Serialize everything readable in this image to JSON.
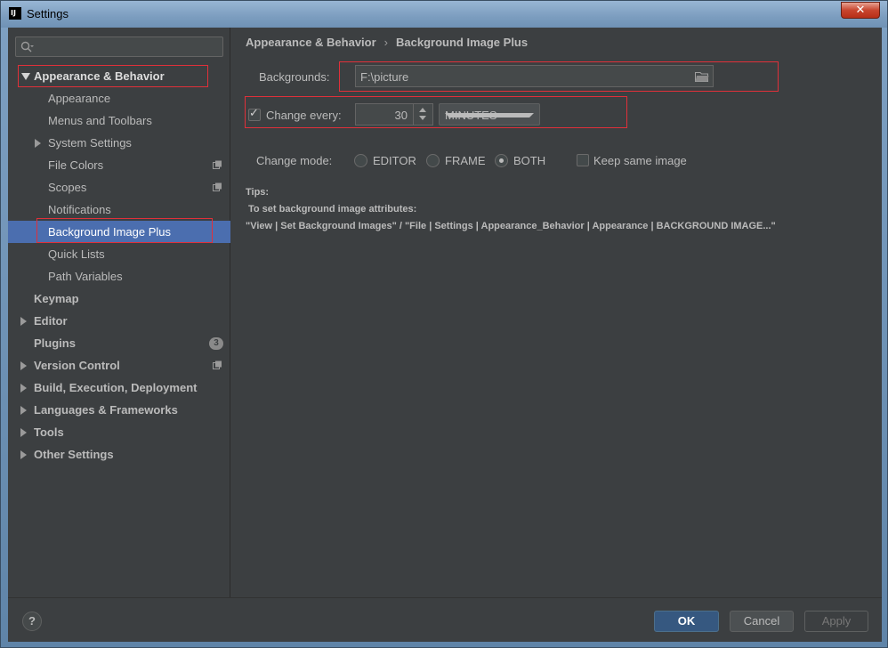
{
  "window": {
    "title": "Settings",
    "app_icon": "IJ",
    "close_label": "✕"
  },
  "search": {
    "placeholder": ""
  },
  "sidebar": {
    "items": [
      {
        "label": "Appearance & Behavior"
      },
      {
        "label": "Appearance"
      },
      {
        "label": "Menus and Toolbars"
      },
      {
        "label": "System Settings"
      },
      {
        "label": "File Colors"
      },
      {
        "label": "Scopes"
      },
      {
        "label": "Notifications"
      },
      {
        "label": "Background Image Plus"
      },
      {
        "label": "Quick Lists"
      },
      {
        "label": "Path Variables"
      },
      {
        "label": "Keymap"
      },
      {
        "label": "Editor"
      },
      {
        "label": "Plugins",
        "badge": "3"
      },
      {
        "label": "Version Control"
      },
      {
        "label": "Build, Execution, Deployment"
      },
      {
        "label": "Languages & Frameworks"
      },
      {
        "label": "Tools"
      },
      {
        "label": "Other Settings"
      }
    ]
  },
  "breadcrumb": {
    "parent": "Appearance & Behavior",
    "separator": "›",
    "current": "Background Image Plus"
  },
  "settings": {
    "backgrounds_label": "Backgrounds:",
    "backgrounds_value": "F:\\picture",
    "change_every_label": "Change every:",
    "change_every_value": "30",
    "unit_value": "MINUTES",
    "change_mode_label": "Change mode:",
    "mode_editor": "EDITOR",
    "mode_frame": "FRAME",
    "mode_both": "BOTH",
    "keep_same_image": "Keep same image"
  },
  "tips": {
    "title": "Tips:",
    "line1": "To set background image attributes:",
    "line2": "\"View | Set Background Images\" / \"File | Settings | Appearance_Behavior | Appearance | BACKGROUND IMAGE...\""
  },
  "footer": {
    "help": "?",
    "ok": "OK",
    "cancel": "Cancel",
    "apply": "Apply"
  },
  "colors": {
    "selection": "#4b6eaf",
    "highlight_box": "#e0303a",
    "ok_button": "#365880"
  }
}
